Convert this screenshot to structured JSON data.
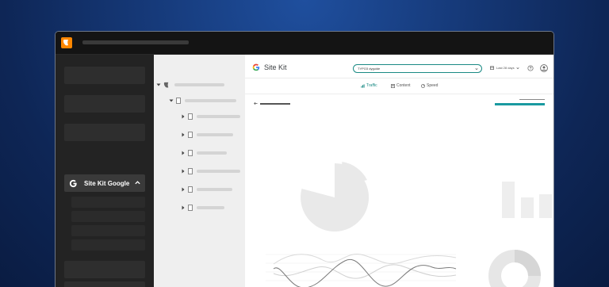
{
  "module_menu": {
    "sitekit_label": "Site Kit Google"
  },
  "sitekit": {
    "title": "Site Kit",
    "search_value": "TYPO3 dyguide",
    "date_range": "Last 28 days",
    "tabs": [
      {
        "label": "Traffic",
        "icon": "chart-icon",
        "active": true
      },
      {
        "label": "Content",
        "icon": "document-icon",
        "active": false
      },
      {
        "label": "Speed",
        "icon": "speed-icon",
        "active": false
      }
    ]
  },
  "colors": {
    "accent": "#1a8a84",
    "typo3_orange": "#ff8700",
    "background_blue": "#163a7a"
  }
}
